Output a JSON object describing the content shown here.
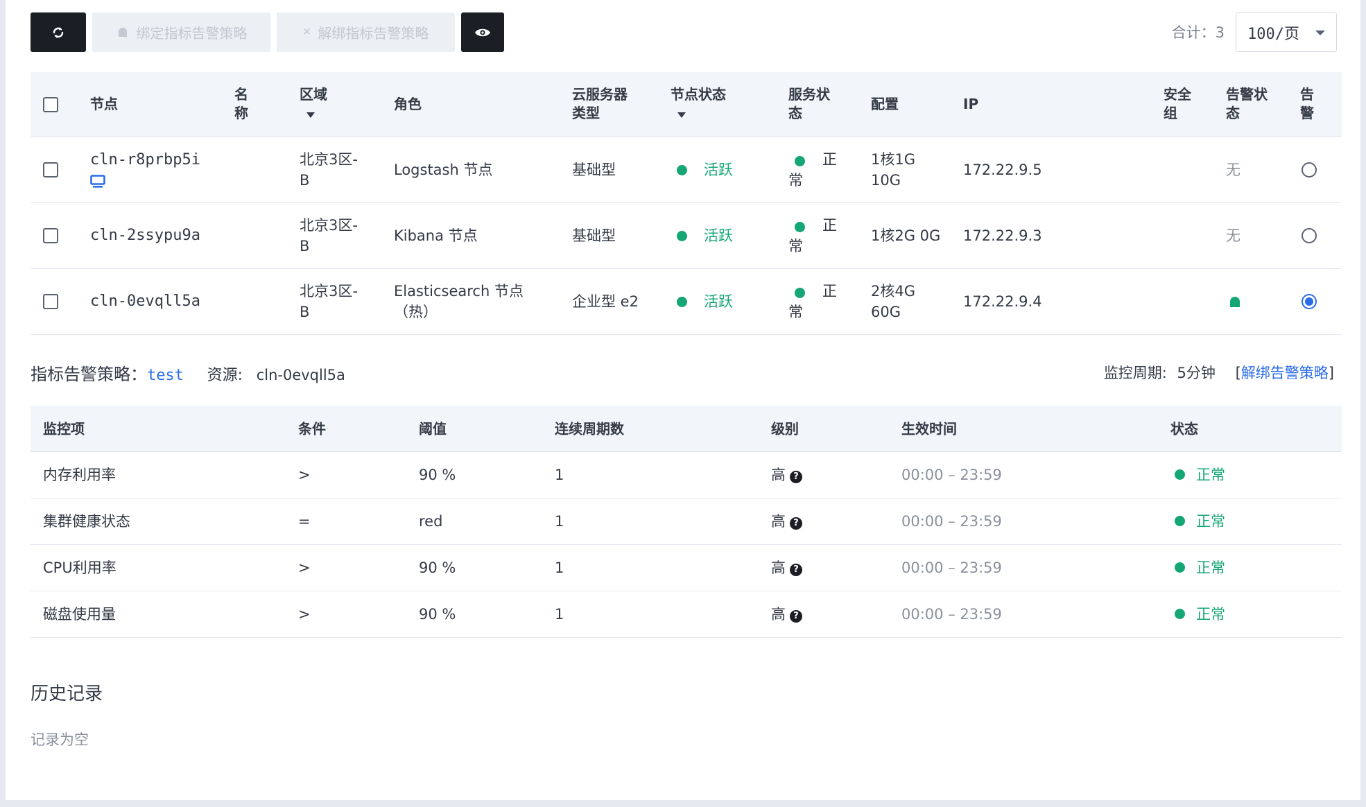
{
  "toolbar": {
    "bind_label": "绑定指标告警策略",
    "unbind_label": "解绑指标告警策略",
    "total": "合计：3",
    "page_size": "100/页"
  },
  "node_table": {
    "headers": {
      "node": "节点",
      "name_l1": "名",
      "name_l2": "称",
      "zone": "区域",
      "role": "角色",
      "type_l1": "云服务器",
      "type_l2": "类型",
      "node_status": "节点状态",
      "svc_l1": "服务状",
      "svc_l2": "态",
      "config": "配置",
      "ip": "IP",
      "sg_l1": "安全",
      "sg_l2": "组",
      "alert_l1": "告警状",
      "alert_l2": "态",
      "al_l1": "告",
      "al_l2": "警"
    },
    "rows": [
      {
        "node": "cln-r8prbp5i",
        "zone_l1": "北京3区-",
        "zone_l2": "B",
        "role_l1": "Logstash 节点",
        "role_l2": "",
        "type": "基础型",
        "status": "活跃",
        "svc_l1": "正",
        "svc_l2": "常",
        "config_l1": "1核1G",
        "config_l2": "10G",
        "ip": "172.22.9.5",
        "alert": "无",
        "selected": false
      },
      {
        "node": "cln-2ssypu9a",
        "zone_l1": "北京3区-",
        "zone_l2": "B",
        "role_l1": "Kibana 节点",
        "role_l2": "",
        "type": "基础型",
        "status": "活跃",
        "svc_l1": "正",
        "svc_l2": "常",
        "config_l1": "1核2G 0G",
        "config_l2": "",
        "ip": "172.22.9.3",
        "alert": "无",
        "selected": false
      },
      {
        "node": "cln-0evqll5a",
        "zone_l1": "北京3区-",
        "zone_l2": "B",
        "role_l1": "Elasticsearch 节点",
        "role_l2": "（热）",
        "type": "企业型 e2",
        "status": "活跃",
        "svc_l1": "正",
        "svc_l2": "常",
        "config_l1": "2核4G",
        "config_l2": "60G",
        "ip": "172.22.9.4",
        "alert": "",
        "selected": true
      }
    ]
  },
  "policy": {
    "label": "指标告警策略：",
    "name": "test",
    "resource_label": "资源:",
    "resource": "cln-0evqll5a",
    "period_label": "监控周期:",
    "period": "5分钟",
    "unbind_link": "解绑告警策略"
  },
  "metric_table": {
    "headers": {
      "item": "监控项",
      "cond": "条件",
      "threshold": "阈值",
      "periods": "连续周期数",
      "level": "级别",
      "time": "生效时间",
      "status": "状态"
    },
    "rows": [
      {
        "item": "内存利用率",
        "cond": ">",
        "threshold": "90 %",
        "periods": "1",
        "level": "高",
        "time": "00:00 – 23:59",
        "status": "正常"
      },
      {
        "item": "集群健康状态",
        "cond": "=",
        "threshold": "red",
        "periods": "1",
        "level": "高",
        "time": "00:00 – 23:59",
        "status": "正常"
      },
      {
        "item": "CPU利用率",
        "cond": ">",
        "threshold": "90 %",
        "periods": "1",
        "level": "高",
        "time": "00:00 – 23:59",
        "status": "正常"
      },
      {
        "item": "磁盘使用量",
        "cond": ">",
        "threshold": "90 %",
        "periods": "1",
        "level": "高",
        "time": "00:00 – 23:59",
        "status": "正常"
      }
    ]
  },
  "history": {
    "title": "历史记录",
    "empty": "记录为空"
  },
  "colors": {
    "accent": "#2a6ce8",
    "success": "#15a675",
    "dark_button": "#1b1e25"
  }
}
